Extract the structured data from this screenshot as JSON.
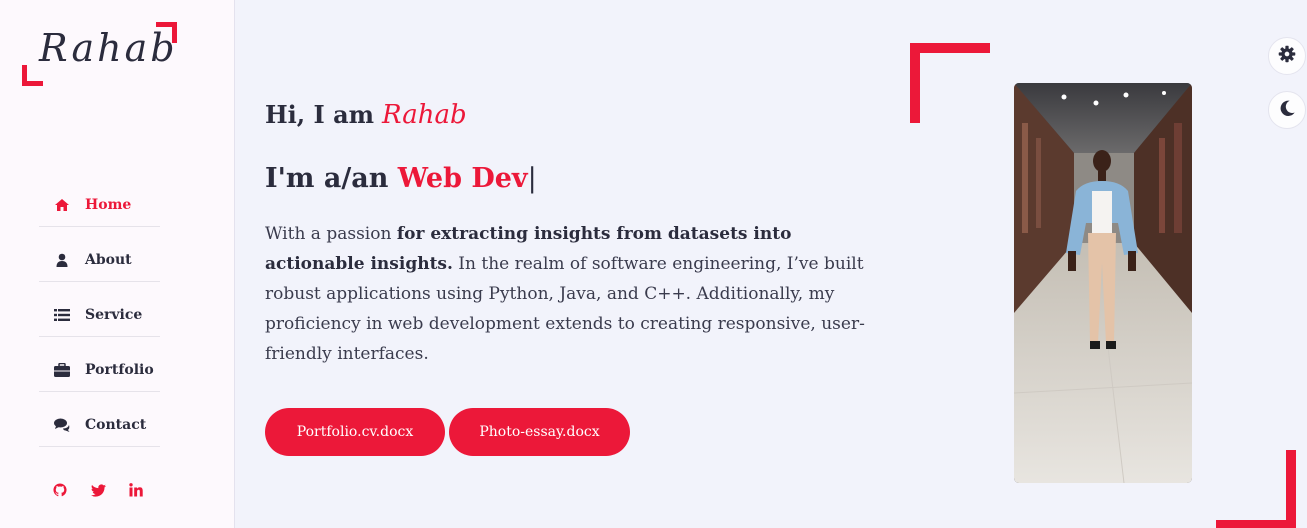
{
  "brand": {
    "logo_text": "Rahab",
    "accent": "#ec1839",
    "text_color": "#2b2c3d"
  },
  "nav": {
    "items": [
      {
        "label": "Home",
        "icon": "home-icon",
        "active": true
      },
      {
        "label": "About",
        "icon": "user-icon",
        "active": false
      },
      {
        "label": "Service",
        "icon": "list-icon",
        "active": false
      },
      {
        "label": "Portfolio",
        "icon": "briefcase-icon",
        "active": false
      },
      {
        "label": "Contact",
        "icon": "comments-icon",
        "active": false
      }
    ]
  },
  "socials": [
    "github-icon",
    "twitter-icon",
    "linkedin-icon"
  ],
  "hero": {
    "greeting": "Hi, I am",
    "name": "Rahab",
    "role_prefix": "I'm a/an",
    "role_typed": "Web Dev",
    "role_cursor": "|",
    "desc_intro": "With a passion ",
    "desc_bold": "for extracting insights from datasets into actionable insights.",
    "desc_rest": " In the realm of software engineering, I’ve built robust applications using Python, Java, and C++. Additionally, my proficiency in web development extends to creating responsive, user-friendly interfaces.",
    "buttons": [
      "Portfolio.cv.docx",
      "Photo-essay.docx"
    ]
  },
  "controls": {
    "settings_icon": "gear-icon",
    "theme_icon": "moon-icon"
  }
}
